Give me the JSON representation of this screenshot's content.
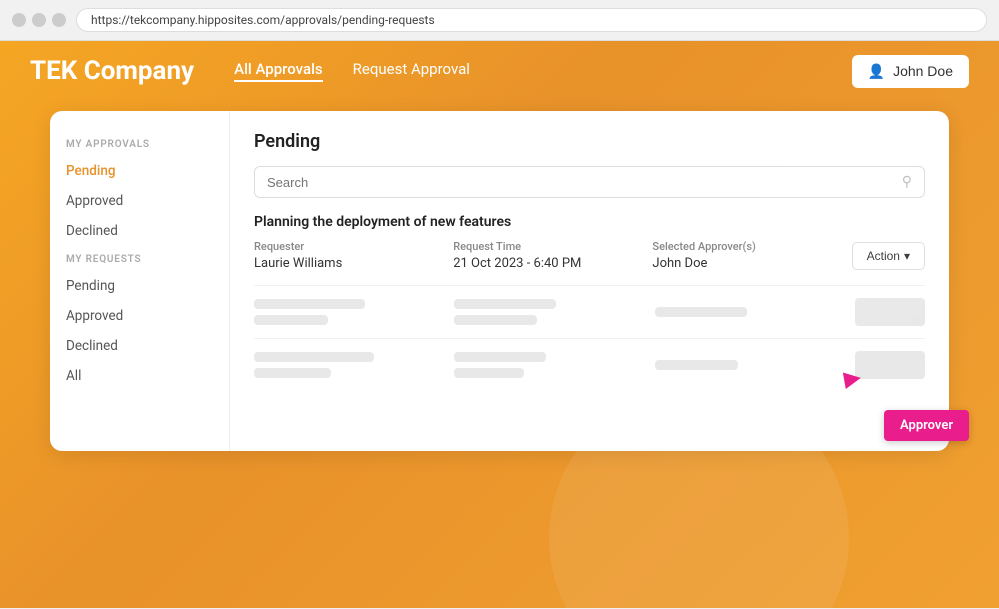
{
  "browser": {
    "url": "https://tekcompany.hipposites.com/approvals/pending-requests"
  },
  "header": {
    "logo": "TEK Company",
    "nav": [
      {
        "label": "All Approvals",
        "active": true
      },
      {
        "label": "Request Approval",
        "active": false
      }
    ],
    "user_button": "John Doe"
  },
  "sidebar": {
    "my_approvals_label": "MY APPROVALS",
    "my_approvals_items": [
      {
        "label": "Pending",
        "active": true
      },
      {
        "label": "Approved",
        "active": false
      },
      {
        "label": "Declined",
        "active": false
      }
    ],
    "my_requests_label": "MY REQUESTS",
    "my_requests_items": [
      {
        "label": "Pending",
        "active": false
      },
      {
        "label": "Approved",
        "active": false
      },
      {
        "label": "Declined",
        "active": false
      },
      {
        "label": "All",
        "active": false
      }
    ]
  },
  "content": {
    "title": "Pending",
    "search_placeholder": "Search",
    "approval_item": {
      "title": "Planning the deployment of new features",
      "requester_label": "Requester",
      "requester_value": "Laurie Williams",
      "request_time_label": "Request Time",
      "request_time_value": "21 Oct 2023 - 6:40 PM",
      "approver_label": "Selected Approver(s)",
      "approver_value": "John Doe",
      "action_label": "Action"
    }
  },
  "approver_badge": {
    "label": "Approver"
  },
  "icons": {
    "search": "🔍",
    "chevron_down": "▾",
    "user": "👤",
    "cursor": "▶"
  }
}
